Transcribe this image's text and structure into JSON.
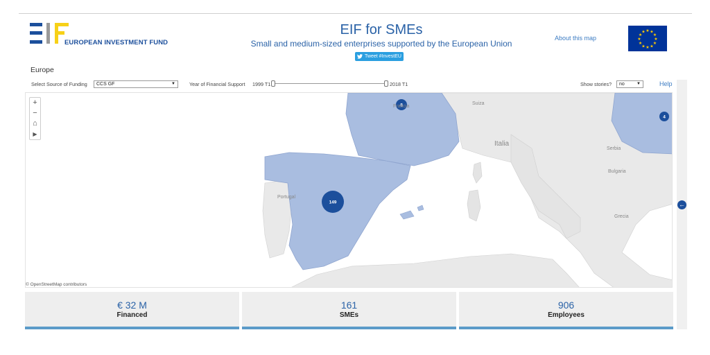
{
  "header": {
    "logo_text": "EUROPEAN INVESTMENT FUND",
    "title": "EIF for SMEs",
    "subtitle": "Small and medium-sized enterprises supported by the European Union",
    "tweet_label": "Tweet #InvestEU",
    "about_label": "About this map"
  },
  "controls": {
    "region": "Europe",
    "source_label": "Select Source of Funding",
    "source_value": "CCS GF",
    "year_label": "Year of Financial Support",
    "year_start": "1999 T1",
    "year_end": "2018 T1",
    "stories_label": "Show stories?",
    "stories_value": "no",
    "help_label": "Help"
  },
  "map": {
    "attribution": "© OpenStreetMap contributors",
    "country_labels": [
      "Suiza",
      "Italia",
      "Serbia",
      "Bulgaria",
      "Portugal",
      "Grecia",
      "Francia"
    ],
    "clusters": [
      {
        "label": "8"
      },
      {
        "label": "4"
      },
      {
        "label": "149"
      }
    ],
    "colors": {
      "highlight": "#a9bde0",
      "cluster": "#1c4f9c",
      "land": "#e8e8e8",
      "sea": "#ffffff"
    }
  },
  "stats": [
    {
      "value": "€ 32 M",
      "label": "Financed"
    },
    {
      "value": "161",
      "label": "SMEs"
    },
    {
      "value": "906",
      "label": "Employees"
    }
  ]
}
